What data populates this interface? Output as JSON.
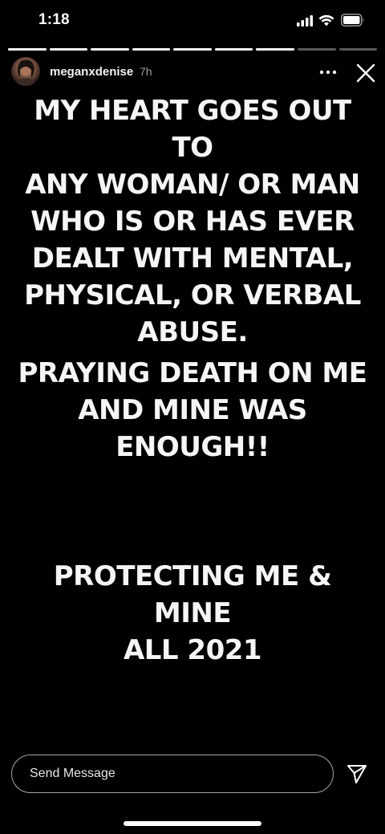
{
  "status_bar": {
    "time": "1:18"
  },
  "story": {
    "segments_total": 9,
    "segments_viewed": 7,
    "username": "meganxdenise",
    "timestamp": "7h",
    "text_blocks": [
      "MY HEART GOES OUT TO\nANY WOMAN/ OR MAN\nWHO IS OR HAS EVER\nDEALT WITH MENTAL,\nPHYSICAL, OR VERBAL\nABUSE.",
      "PRAYING DEATH ON ME\nAND MINE WAS\nENOUGH!!",
      "PROTECTING ME & MINE\nALL 2021"
    ]
  },
  "reply": {
    "placeholder": "Send Message"
  },
  "icons": {
    "more": "more-options-icon",
    "close": "close-icon",
    "send": "send-icon"
  },
  "colors": {
    "background": "#000000",
    "text": "#f5f5f5"
  }
}
